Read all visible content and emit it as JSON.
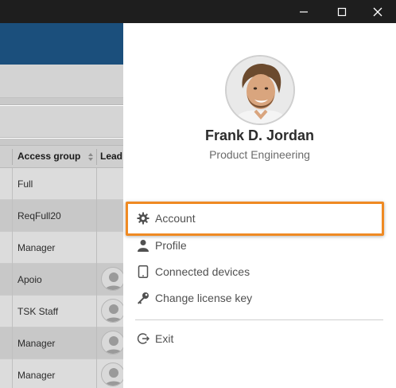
{
  "window": {
    "minimize_icon": "minimize-icon",
    "maximize_icon": "maximize-icon",
    "close_icon": "close-icon"
  },
  "background_table": {
    "columns": [
      "Access group",
      "Lead"
    ],
    "rows": [
      {
        "access_group": "Full",
        "has_avatar": false
      },
      {
        "access_group": "ReqFull20",
        "has_avatar": false
      },
      {
        "access_group": "Manager",
        "has_avatar": false
      },
      {
        "access_group": "Apoio",
        "has_avatar": true
      },
      {
        "access_group": "TSK Staff",
        "has_avatar": true
      },
      {
        "access_group": "Manager",
        "has_avatar": true
      },
      {
        "access_group": "Manager",
        "has_avatar": true
      }
    ]
  },
  "user": {
    "name": "Frank D. Jordan",
    "department": "Product Engineering"
  },
  "menu": {
    "items": [
      {
        "label": "Account",
        "icon": "gear-icon",
        "highlighted": true
      },
      {
        "label": "Profile",
        "icon": "person-icon",
        "highlighted": false
      },
      {
        "label": "Connected devices",
        "icon": "tablet-icon",
        "highlighted": false
      },
      {
        "label": "Change license key",
        "icon": "key-icon",
        "highlighted": false
      }
    ],
    "exit": {
      "label": "Exit",
      "icon": "exit-icon"
    }
  },
  "colors": {
    "titlebar": "#1e1e1e",
    "banner": "#1b4f7c",
    "highlight_border": "#ef8a23",
    "menu_text": "#505050"
  }
}
